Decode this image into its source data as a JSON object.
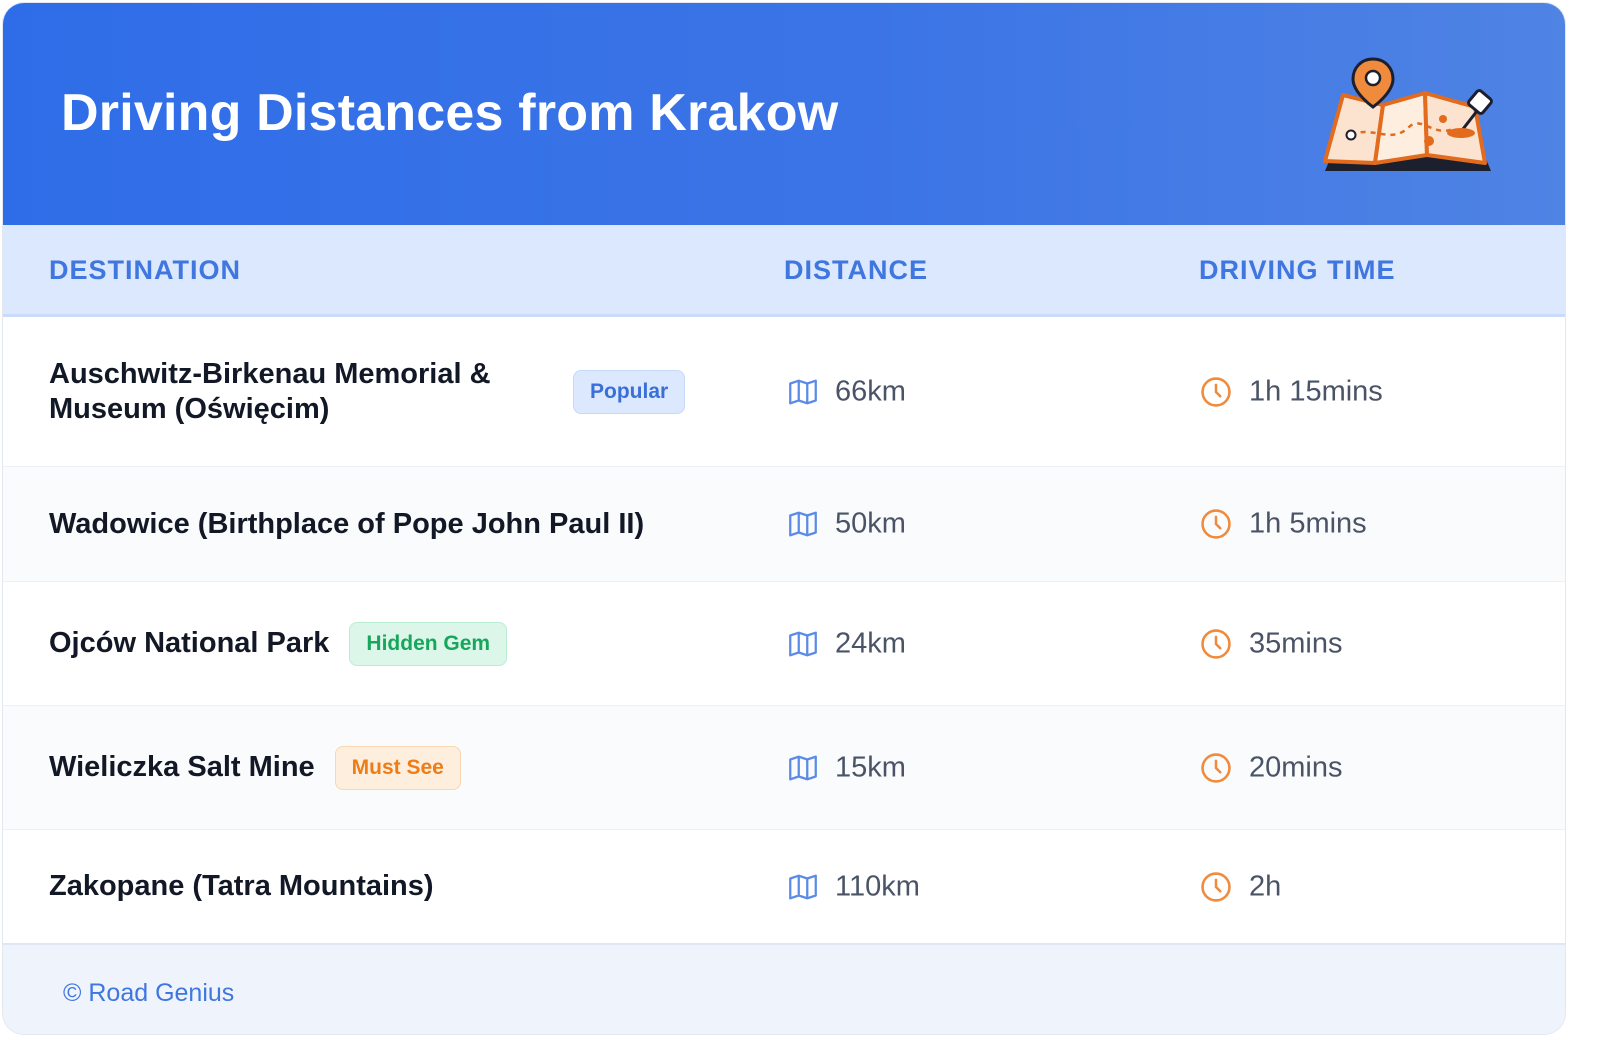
{
  "header": {
    "title": "Driving Distances from Krakow",
    "illustration_icon": "folded-map-with-pins-icon",
    "gradient_start": "#2f6de8",
    "gradient_end": "#4f83e4"
  },
  "table": {
    "columns": {
      "destination": "DESTINATION",
      "distance": "DISTANCE",
      "driving_time": "DRIVING TIME"
    },
    "distance_icon": "map-icon",
    "time_icon": "clock-icon",
    "rows": [
      {
        "destination": "Auschwitz-Birkenau Memorial & Museum (Oświęcim)",
        "badge": "Popular",
        "badge_color": "blue",
        "distance": "66km",
        "time": "1h 15mins"
      },
      {
        "destination": "Wadowice (Birthplace of Pope John Paul II)",
        "badge": "",
        "badge_color": "",
        "distance": "50km",
        "time": "1h 5mins"
      },
      {
        "destination": "Ojców National Park",
        "badge": "Hidden Gem",
        "badge_color": "green",
        "distance": "24km",
        "time": "35mins"
      },
      {
        "destination": "Wieliczka Salt Mine",
        "badge": "Must See",
        "badge_color": "orange",
        "distance": "15km",
        "time": "20mins"
      },
      {
        "destination": "Zakopane (Tatra Mountains)",
        "badge": "",
        "badge_color": "",
        "distance": "110km",
        "time": "2h"
      }
    ]
  },
  "footer": {
    "copyright": "© Road Genius"
  },
  "colors": {
    "accent": "#3f76df",
    "clock_orange": "#f08a3c",
    "map_icon_blue": "#5b8be6"
  }
}
